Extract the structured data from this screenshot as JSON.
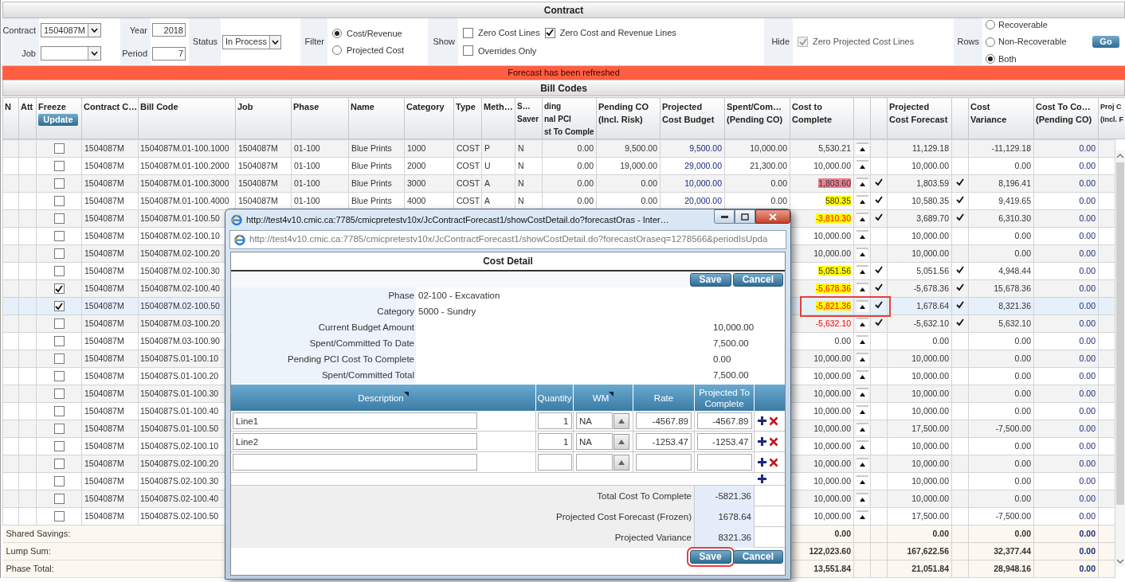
{
  "contract_panel": {
    "title": "Contract",
    "contract": {
      "label": "Contract",
      "value": "1504087M"
    },
    "job": {
      "label": "Job"
    },
    "year": {
      "label": "Year",
      "value": "2018"
    },
    "period": {
      "label": "Period",
      "value": "7"
    },
    "status": {
      "label": "Status",
      "value": "In Process"
    },
    "filter": {
      "label": "Filter",
      "options": [
        {
          "label": "Cost/Revenue",
          "selected": true
        },
        {
          "label": "Projected Cost",
          "selected": false
        }
      ]
    },
    "show": {
      "label": "Show",
      "options": [
        {
          "label": "Zero Cost Lines",
          "checked": false,
          "disabled": false
        },
        {
          "label": "Zero Cost and Revenue Lines",
          "checked": true,
          "disabled": false
        },
        {
          "label": "Overrides Only",
          "checked": false,
          "disabled": false
        }
      ]
    },
    "hide": {
      "label": "Hide",
      "options": [
        {
          "label": "Zero Projected Cost Lines",
          "checked": true,
          "disabled": true
        }
      ]
    },
    "rows_filter": {
      "label": "Rows",
      "options": [
        {
          "label": "Recoverable",
          "selected": false
        },
        {
          "label": "Non-Recoverable",
          "selected": false
        },
        {
          "label": "Both",
          "selected": true
        }
      ]
    },
    "go_button": "Go"
  },
  "message": "Forecast has been refreshed",
  "bill_codes": {
    "title": "Bill Codes",
    "columns": [
      {
        "kind": "text",
        "lines": [
          "N"
        ]
      },
      {
        "kind": "text",
        "lines": [
          "Att"
        ]
      },
      {
        "kind": "text",
        "lines": [
          "Freeze"
        ],
        "button": "Update"
      },
      {
        "kind": "text",
        "lines": [
          "Contract C…"
        ]
      },
      {
        "kind": "text",
        "lines": [
          "Bill Code"
        ]
      },
      {
        "kind": "text",
        "lines": [
          "Job"
        ]
      },
      {
        "kind": "text",
        "lines": [
          "Phase"
        ]
      },
      {
        "kind": "text",
        "lines": [
          "Name"
        ]
      },
      {
        "kind": "text",
        "lines": [
          "Category"
        ]
      },
      {
        "kind": "text",
        "lines": [
          "Type"
        ]
      },
      {
        "kind": "text",
        "lines": [
          "Meth…"
        ]
      },
      {
        "kind": "text",
        "lines": [
          "S…",
          "Saver"
        ]
      },
      {
        "kind": "text",
        "lines": [
          "ding",
          "nal PCI",
          "st To Comple"
        ]
      },
      {
        "kind": "text",
        "lines": [
          "Pending CO",
          "(Incl. Risk)"
        ]
      },
      {
        "kind": "text",
        "lines": [
          "Projected",
          "Cost Budget"
        ]
      },
      {
        "kind": "text",
        "lines": [
          "Spent/Com…",
          "(Pending CO)"
        ]
      },
      {
        "kind": "text",
        "lines": [
          "Cost to",
          "Complete"
        ]
      },
      {
        "kind": "button"
      },
      {
        "kind": "check"
      },
      {
        "kind": "text",
        "lines": [
          "Projected",
          "Cost Forecast"
        ]
      },
      {
        "kind": "check"
      },
      {
        "kind": "text",
        "lines": [
          "Cost",
          "Variance"
        ]
      },
      {
        "kind": "text",
        "lines": [
          "Cost To Co…",
          "(Pending CO)"
        ]
      },
      {
        "kind": "text",
        "lines": [
          "Proj C",
          "(Incl. F"
        ]
      }
    ],
    "rows": [
      {
        "selected": false,
        "annotated": false,
        "freeze": false,
        "contract": "1504087M",
        "bill_code": "1504087M.01-100.1000",
        "job": "1504087M",
        "phase": "01-100",
        "name": "Blue Prints",
        "category": "1000",
        "type": "COST",
        "method": "P",
        "s": "N",
        "pci": "0.00",
        "pending_co": "9,500.00",
        "budget": "9,500.00",
        "spent": "10,000.00",
        "ctc": "5,530.21",
        "ctc_alert": false,
        "ctc_checked": false,
        "forecast": "11,129.18",
        "forecast_checked": false,
        "variance": "-11,129.18",
        "ctc_pending": "0.00"
      },
      {
        "selected": false,
        "annotated": false,
        "freeze": false,
        "contract": "1504087M",
        "bill_code": "1504087M.01-100.2000",
        "job": "1504087M",
        "phase": "01-100",
        "name": "Blue Prints",
        "category": "2000",
        "type": "COST",
        "method": "U",
        "s": "N",
        "pci": "0.00",
        "pending_co": "19,000.00",
        "budget": "29,000.00",
        "spent": "21,300.00",
        "ctc": "10,000.00",
        "ctc_alert": false,
        "ctc_checked": false,
        "forecast": "10,000.00",
        "forecast_checked": false,
        "variance": "0.00",
        "ctc_pending": "0.00"
      },
      {
        "selected": false,
        "annotated": false,
        "freeze": false,
        "contract": "1504087M",
        "bill_code": "1504087M.01-100.3000",
        "job": "1504087M",
        "phase": "01-100",
        "name": "Blue Prints",
        "category": "3000",
        "type": "COST",
        "method": "A",
        "s": "N",
        "pci": "0.00",
        "pending_co": "0.00",
        "budget": "10,000.00",
        "spent": "0.00",
        "ctc": "1,803.60",
        "color": "#e8818f",
        "ctc_alert": false,
        "ctc_checked": true,
        "forecast": "1,803.59",
        "forecast_checked": true,
        "variance": "8,196.41",
        "ctc_pending": "0.00"
      },
      {
        "selected": false,
        "annotated": false,
        "freeze": false,
        "contract": "1504087M",
        "bill_code": "1504087M.01-100.4000",
        "job": "1504087M",
        "phase": "01-100",
        "name": "Blue Prints",
        "category": "4000",
        "type": "COST",
        "method": "A",
        "s": "N",
        "pci": "0.00",
        "pending_co": "0.00",
        "budget": "20,000.00",
        "spent": "0.00",
        "ctc": "580.35",
        "color": "#ffff00",
        "ctc_alert": false,
        "ctc_checked": true,
        "forecast": "10,580.35",
        "forecast_checked": true,
        "variance": "9,419.65",
        "ctc_pending": "0.00"
      },
      {
        "selected": false,
        "annotated": false,
        "freeze": false,
        "contract": "1504087M",
        "bill_code": "1504087M.01-100.50",
        "ctc": "-3,810.30",
        "color": "#ffff00",
        "ctc_alert": true,
        "ctc_checked": true,
        "forecast": "3,689.70",
        "forecast_checked": true,
        "variance": "6,310.30",
        "ctc_pending": "0.00"
      },
      {
        "selected": false,
        "annotated": false,
        "freeze": false,
        "contract": "1504087M",
        "bill_code": "1504087M.02-100.10",
        "ctc": "10,000.00",
        "ctc_alert": false,
        "ctc_checked": false,
        "forecast": "10,000.00",
        "forecast_checked": false,
        "variance": "0.00",
        "ctc_pending": "0.00"
      },
      {
        "selected": false,
        "annotated": false,
        "freeze": false,
        "contract": "1504087M",
        "bill_code": "1504087M.02-100.20",
        "ctc": "10,000.00",
        "ctc_alert": false,
        "ctc_checked": false,
        "forecast": "10,000.00",
        "forecast_checked": false,
        "variance": "0.00",
        "ctc_pending": "0.00"
      },
      {
        "selected": false,
        "annotated": false,
        "freeze": false,
        "contract": "1504087M",
        "bill_code": "1504087M.02-100.30",
        "ctc": "5,051.56",
        "color": "#ffff00",
        "ctc_alert": false,
        "ctc_checked": true,
        "forecast": "5,051.56",
        "forecast_checked": true,
        "variance": "4,948.44",
        "ctc_pending": "0.00"
      },
      {
        "selected": false,
        "annotated": false,
        "freeze": true,
        "contract": "1504087M",
        "bill_code": "1504087M.02-100.40",
        "ctc": "-5,678.36",
        "color": "#ffff00",
        "ctc_alert": true,
        "ctc_checked": true,
        "forecast": "-5,678.36",
        "forecast_checked": true,
        "variance": "15,678.36",
        "ctc_pending": "0.00"
      },
      {
        "selected": true,
        "annotated": true,
        "freeze": true,
        "contract": "1504087M",
        "bill_code": "1504087M.02-100.50",
        "ctc": "-5,821.36",
        "color": "#ffff00",
        "ctc_alert": true,
        "ctc_checked": true,
        "forecast": "1,678.64",
        "forecast_checked": true,
        "variance": "8,321.36",
        "ctc_pending": "0.00"
      },
      {
        "selected": false,
        "annotated": false,
        "freeze": false,
        "contract": "1504087M",
        "bill_code": "1504087M.03-100.20",
        "ctc": "-5,632.10",
        "ctc_alert": true,
        "ctc_checked": true,
        "forecast": "-5,632.10",
        "forecast_checked": true,
        "variance": "5,632.10",
        "ctc_pending": "0.00"
      },
      {
        "selected": false,
        "annotated": false,
        "freeze": false,
        "contract": "1504087M",
        "bill_code": "1504087M.03-100.90",
        "ctc": "0.00",
        "ctc_alert": false,
        "ctc_checked": false,
        "forecast": "0.00",
        "forecast_checked": false,
        "variance": "0.00",
        "ctc_pending": "0.00"
      },
      {
        "selected": false,
        "annotated": false,
        "freeze": false,
        "contract": "1504087M",
        "bill_code": "1504087S.01-100.10",
        "ctc": "10,000.00",
        "ctc_alert": false,
        "ctc_checked": false,
        "forecast": "10,000.00",
        "forecast_checked": false,
        "variance": "0.00",
        "ctc_pending": "0.00"
      },
      {
        "selected": false,
        "annotated": false,
        "freeze": false,
        "contract": "1504087M",
        "bill_code": "1504087S.01-100.20",
        "ctc": "10,000.00",
        "ctc_alert": false,
        "ctc_checked": false,
        "forecast": "10,000.00",
        "forecast_checked": false,
        "variance": "0.00",
        "ctc_pending": "0.00"
      },
      {
        "selected": false,
        "annotated": false,
        "freeze": false,
        "contract": "1504087M",
        "bill_code": "1504087S.01-100.30",
        "ctc": "10,000.00",
        "ctc_alert": false,
        "ctc_checked": false,
        "forecast": "10,000.00",
        "forecast_checked": false,
        "variance": "0.00",
        "ctc_pending": "0.00"
      },
      {
        "selected": false,
        "annotated": false,
        "freeze": false,
        "contract": "1504087M",
        "bill_code": "1504087S.01-100.40",
        "ctc": "10,000.00",
        "ctc_alert": false,
        "ctc_checked": false,
        "forecast": "10,000.00",
        "forecast_checked": false,
        "variance": "0.00",
        "ctc_pending": "0.00"
      },
      {
        "selected": false,
        "annotated": false,
        "freeze": false,
        "contract": "1504087M",
        "bill_code": "1504087S.01-100.50",
        "ctc": "10,000.00",
        "ctc_alert": false,
        "ctc_checked": false,
        "forecast": "17,500.00",
        "forecast_checked": false,
        "variance": "-7,500.00",
        "ctc_pending": "0.00"
      },
      {
        "selected": false,
        "annotated": false,
        "freeze": false,
        "contract": "1504087M",
        "bill_code": "1504087S.02-100.10",
        "ctc": "10,000.00",
        "ctc_alert": false,
        "ctc_checked": false,
        "forecast": "10,000.00",
        "forecast_checked": false,
        "variance": "0.00",
        "ctc_pending": "0.00"
      },
      {
        "selected": false,
        "annotated": false,
        "freeze": false,
        "contract": "1504087M",
        "bill_code": "1504087S.02-100.20",
        "ctc": "10,000.00",
        "ctc_alert": false,
        "ctc_checked": false,
        "forecast": "10,000.00",
        "forecast_checked": false,
        "variance": "0.00",
        "ctc_pending": "0.00"
      },
      {
        "selected": false,
        "annotated": false,
        "freeze": false,
        "contract": "1504087M",
        "bill_code": "1504087S.02-100.30",
        "ctc": "10,000.00",
        "ctc_alert": false,
        "ctc_checked": false,
        "forecast": "10,000.00",
        "forecast_checked": false,
        "variance": "0.00",
        "ctc_pending": "0.00"
      },
      {
        "selected": false,
        "annotated": false,
        "freeze": false,
        "contract": "1504087M",
        "bill_code": "1504087S.02-100.40",
        "ctc": "10,000.00",
        "ctc_alert": false,
        "ctc_checked": false,
        "forecast": "10,000.00",
        "forecast_checked": false,
        "variance": "0.00",
        "ctc_pending": "0.00"
      },
      {
        "selected": false,
        "annotated": false,
        "freeze": false,
        "contract": "1504087M",
        "bill_code": "1504087S.02-100.50",
        "ctc": "10,000.00",
        "ctc_alert": false,
        "ctc_checked": false,
        "forecast": "17,500.00",
        "forecast_checked": false,
        "variance": "-7,500.00",
        "ctc_pending": "0.00"
      }
    ],
    "totals": [
      {
        "label": "Shared Savings:",
        "ctc": "0.00",
        "forecast": "0.00",
        "variance": "0.00",
        "ctc_pending": "0.00"
      },
      {
        "label": "Lump Sum:",
        "ctc": "122,023.60",
        "forecast": "167,622.56",
        "variance": "32,377.44",
        "ctc_pending": "0.00"
      },
      {
        "label": "Phase Total:",
        "ctc": "13,551.84",
        "forecast": "21,051.84",
        "variance": "28,948.16",
        "ctc_pending": "0.00"
      }
    ]
  },
  "dialog": {
    "title": "http://test4v10.cmic.ca:7785/cmicpretestv10x/JcContractForecast1/showCostDetail.do?forecastOras - Inter…",
    "address": "http://test4v10.cmic.ca:7785/cmicpretestv10x/JcContractForecast1/showCostDetail.do?forecastOraseq=1278566&periodIsUpda",
    "heading": "Cost Detail",
    "top_buttons": [
      {
        "label": "Save",
        "highlighted": false
      },
      {
        "label": "Cancel",
        "highlighted": false
      }
    ],
    "details": [
      {
        "label": "Phase",
        "value": "02-100 - Excavation",
        "kind": "text"
      },
      {
        "label": "Category",
        "value": "5000 - Sundry",
        "kind": "text"
      },
      {
        "label": "Current Budget Amount",
        "value": "10,000.00",
        "kind": "amount"
      },
      {
        "label": "Spent/Committed To Date",
        "value": "7,500.00",
        "kind": "amount"
      },
      {
        "label": "Pending PCI Cost To Complete",
        "value": "0.00",
        "kind": "amount"
      },
      {
        "label": "Spent/Committed Total",
        "value": "7,500.00",
        "kind": "amount"
      }
    ],
    "grid": {
      "columns": [
        {
          "lines": [
            "Description"
          ],
          "sortable": true
        },
        {
          "lines": [
            "Quantity"
          ],
          "sortable": false
        },
        {
          "lines": [
            "WM"
          ],
          "sortable": true
        },
        {
          "lines": [
            "Rate"
          ],
          "sortable": false
        },
        {
          "lines": [
            "Projected To",
            "Complete"
          ],
          "sortable": false
        }
      ],
      "rows": [
        {
          "description": "Line1",
          "quantity": "1",
          "wm": "NA",
          "rate": "-4567.89",
          "projected": "-4567.89"
        },
        {
          "description": "Line2",
          "quantity": "1",
          "wm": "NA",
          "rate": "-1253.47",
          "projected": "-1253.47"
        },
        {}
      ]
    },
    "totals": [
      {
        "label": "Total Cost To Complete",
        "value": "-5821.36"
      },
      {
        "label": "Projected Cost Forecast (Frozen)",
        "value": "1678.64"
      },
      {
        "label": "Projected Variance",
        "value": "8321.36"
      }
    ],
    "bottom_buttons": [
      {
        "label": "Save",
        "highlighted": true
      },
      {
        "label": "Cancel",
        "highlighted": false
      }
    ]
  }
}
